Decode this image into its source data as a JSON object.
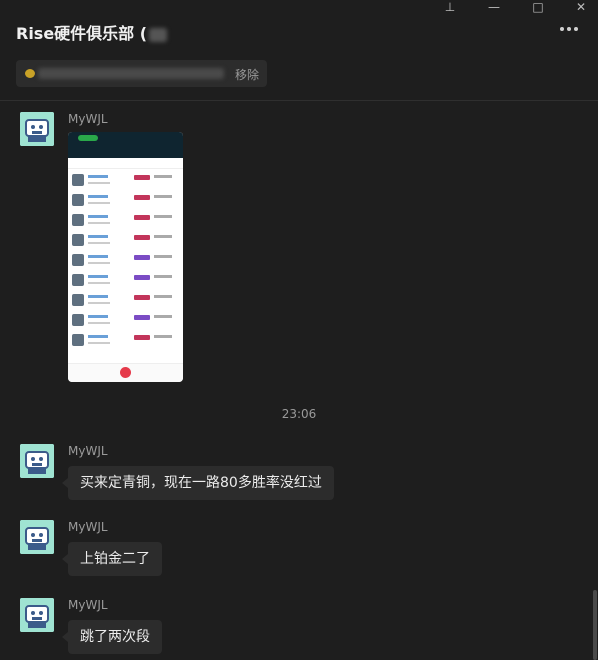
{
  "window": {
    "pin_icon": "pin-icon",
    "min_icon": "minimize-icon",
    "max_icon": "maximize-icon",
    "close_icon": "close-icon"
  },
  "header": {
    "title": "Rise硬件俱乐部 (",
    "more_icon": "more-icon"
  },
  "notice": {
    "remove_label": "移除"
  },
  "messages": [
    {
      "sender": "MyWJL",
      "type": "image"
    },
    {
      "sender": "MyWJL",
      "text": "买来定青铜，现在一路80多胜率没红过"
    },
    {
      "sender": "MyWJL",
      "text": "上铂金二了"
    },
    {
      "sender": "MyWJL",
      "text": "跳了两次段"
    }
  ],
  "timestamp": "23:06",
  "colors": {
    "background": "#1e1e1e",
    "bubble": "#2c2c2c",
    "avatar": "#9fe3d2"
  }
}
